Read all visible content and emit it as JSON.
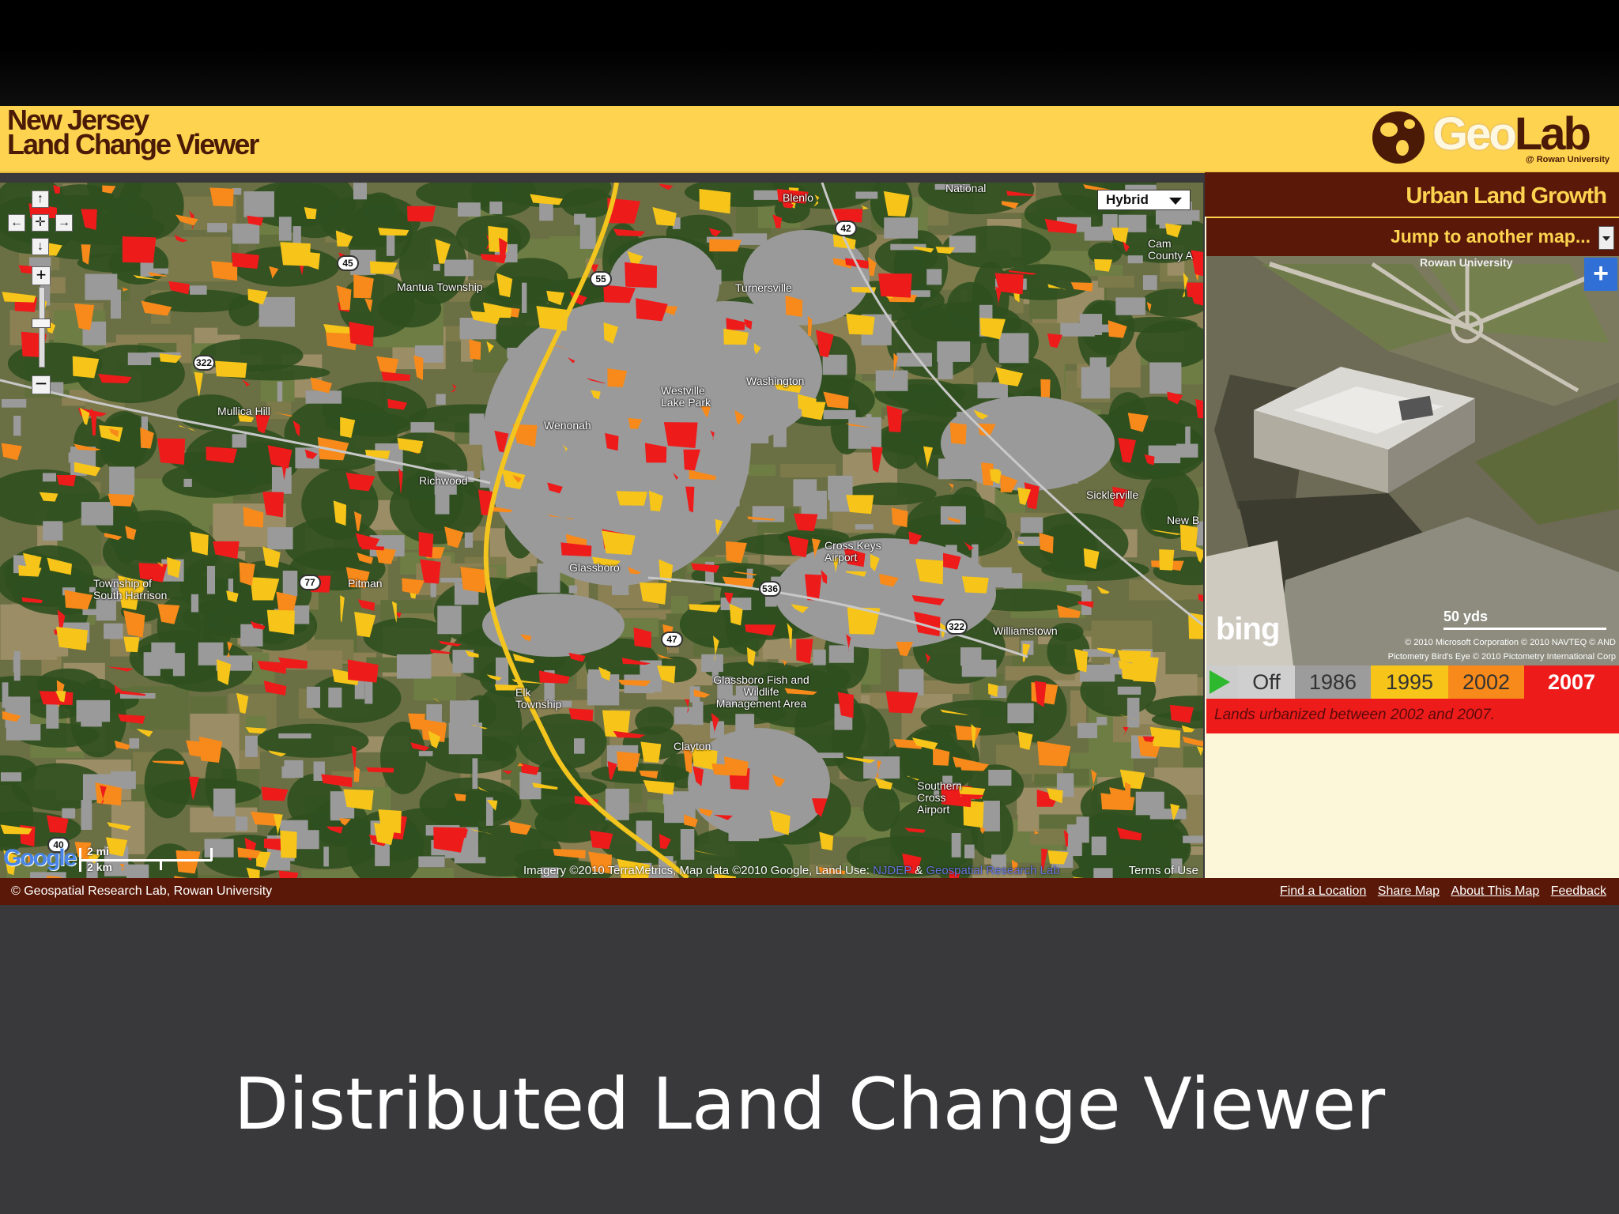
{
  "app": {
    "title_line1": "New Jersey",
    "title_line2": "Land Change Viewer",
    "logo_geo": "Geo",
    "logo_lab": "Lab",
    "logo_sub": "@ Rowan University"
  },
  "map": {
    "type_selector": "Hybrid",
    "scale_mi": "2 mi",
    "scale_km": "2 km",
    "google_logo": "Google",
    "attribution_prefix": "Imagery ©2010 TerraMetrics, Map data ©2010 Google, Land Use: ",
    "attribution_link1": "NJDEP",
    "attribution_mid": " & ",
    "attribution_link2": "Geospatial Research Lab",
    "terms": "Terms of Use",
    "place_labels": [
      "Mantua Township",
      "Mullica Hill",
      "Richwood",
      "Township of South Harrison",
      "Pitman",
      "Glassboro",
      "Cross Keys Airport",
      "Glassboro Fish and Wildlife Management Area",
      "Elk Township",
      "Clayton",
      "Southern Cross Airport",
      "Williamstown",
      "Sicklerville",
      "Washington",
      "Westville Lake Park",
      "Turnersville",
      "Wenonah",
      "National",
      "Cam County A",
      "New B",
      "Blenlo"
    ],
    "road_shields": [
      "45",
      "322",
      "55",
      "77",
      "47",
      "536",
      "322",
      "42",
      "40"
    ],
    "colors": {
      "built_pre1986": "#9a9a9a",
      "y1995": "#f7c519",
      "y2002": "#f78a1a",
      "y2007": "#ee1b1b",
      "forest": "#2f4f1f"
    }
  },
  "side": {
    "title": "Urban Land Growth",
    "jump": "Jump to another map...",
    "aerial_caption": "Rowan University",
    "bing": "bing",
    "scale": "50 yds",
    "copyright1": "© 2010 Microsoft Corporation   © 2010 NAVTEQ   © AND",
    "copyright2": "Pictometry Bird's Eye © 2010 Pictometry International Corp",
    "timeline": [
      "Off",
      "1986",
      "1995",
      "2002",
      "2007"
    ],
    "timeline_selected": "2007",
    "description": "Lands urbanized between 2002 and 2007."
  },
  "footer": {
    "copyright": "© Geospatial Research Lab, Rowan University",
    "links": [
      "Find a Location",
      "Share Map",
      "About This Map",
      "Feedback"
    ]
  },
  "slide": {
    "title": "Distributed Land Change Viewer"
  }
}
